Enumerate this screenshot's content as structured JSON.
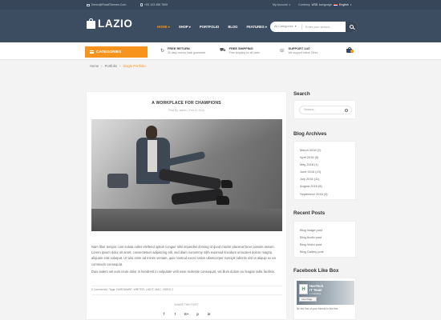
{
  "topbar": {
    "email": "Demo@RoadThemes.Com",
    "phone": "+00 123 456 7890",
    "account": "My Account",
    "currency_label": "Currency",
    "currency_value": "USD",
    "language_label": "Language",
    "language_value": "English"
  },
  "header": {
    "logo_text": "LAZIO",
    "nav": [
      "HOME",
      "SHOP",
      "PORTFOLIO",
      "BLOG",
      "FEATURES"
    ],
    "search": {
      "category": "All Categories",
      "placeholder": "Enter your search..."
    }
  },
  "strip": {
    "categories_label": "CATEGORIES",
    "services": [
      {
        "glyph": "↻",
        "title": "FREE RETURN",
        "subtitle": "30 days money back guarantee"
      },
      {
        "glyph": "⛟",
        "title": "FREE SHIPPING",
        "subtitle": "Free shipping on all order"
      },
      {
        "glyph": "☏",
        "title": "SUPPORT 24/7",
        "subtitle": "We support online 24hrs"
      }
    ]
  },
  "breadcrumb": {
    "items": [
      "Home",
      "Portfolio",
      "Single Portfolio"
    ],
    "separator": "›"
  },
  "post": {
    "title": "A WORKPLACE FOR CHAMPIONS",
    "meta": "Post By: admin  |  Feb 12 2016",
    "paragraphs": [
      "Nam liber tempor cum soluta nobis eleifend option congue nihil imperdiet doming id quod mazim placerat facer possim assum. Lorem ipsum dolor sit amet, consectetuer adipiscing elit, sed diam nonummy nibh euismod tincidunt ut laoreet dolore magna aliquam erat volutpat. Ut wisi enim ad minim veniam, quis nostrud exerci tation ullamcorper suscipit lobortis nisl ut aliquip ex ea commodo consequat.",
      "Duis autem vel eum iriure dolor in hendrerit in vulputate velit esse molestie consequat, vel illum dolore eu feugiat nulla facilisis."
    ],
    "tags_line": "0 Comments  /  Tags: HARDWARE, WRITER, LIGHT, MAC, VIDEO 2",
    "share_label": "SHARE THIS POST",
    "share_icons": [
      "f",
      "t",
      "G+",
      "p",
      "in"
    ]
  },
  "sidebar": {
    "search_title": "Search",
    "search_placeholder": "Search...",
    "archives_title": "Blog Archives",
    "archives": [
      "March 2016 (1)",
      "April 2016 (5)",
      "May 2016 (1)",
      "June 2016 (10)",
      "July 2016 (11)",
      "August 2016 (8)",
      "September 2016 (3)"
    ],
    "recent_title": "Recent Posts",
    "recent": [
      "Blog image post",
      "Blog Audio post",
      "Blog Video post",
      "Blog Gallery post"
    ],
    "facebook_title": "Facebook Like Box",
    "facebook": {
      "page_name_line1": "HasTech",
      "page_name_line2": "IT Team",
      "likes": "1,140 likes",
      "like_button": "Like Page",
      "footer": "Be the first of your friends to like this"
    }
  },
  "colors": {
    "accent": "#f7941d",
    "header_bg": "#3c4d61",
    "topbar_bg": "#374759"
  }
}
